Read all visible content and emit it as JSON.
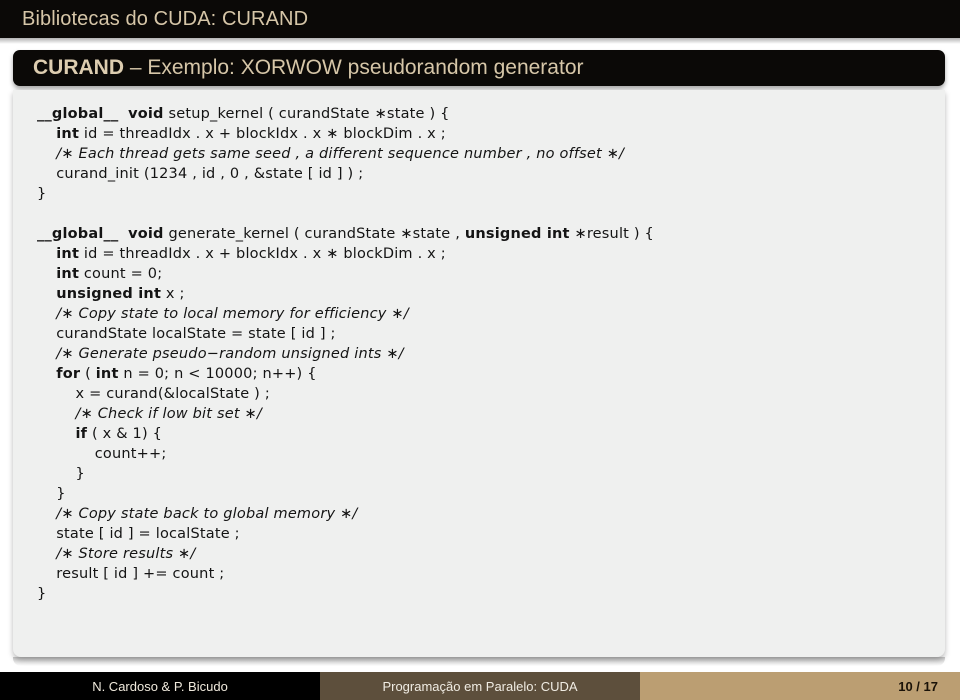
{
  "header": {
    "title": "Bibliotecas do CUDA: CURAND"
  },
  "frame": {
    "title_strong": "CURAND",
    "title_rest": " – Exemplo: XORWOW pseudorandom generator"
  },
  "code": {
    "language": "CUDA C",
    "lines": [
      {
        "id": "l01",
        "html": "<span class=\"kw\">__global__</span>  <span class=\"kw\">void</span> setup_kernel ( curandState ∗state ) {"
      },
      {
        "id": "l02",
        "html": "    <span class=\"kw\">int</span> id = threadIdx . x + blockIdx . x ∗ blockDim . x ;"
      },
      {
        "id": "l03",
        "html": "    <span class=\"cmt\">/∗ Each thread gets same seed , a different sequence number , no offset ∗/</span>"
      },
      {
        "id": "l04",
        "html": "    curand_init (1234 , id , 0 , &amp;state [ id ] ) ;"
      },
      {
        "id": "l05",
        "html": "}"
      },
      {
        "id": "l06",
        "html": ""
      },
      {
        "id": "l07",
        "html": "<span class=\"kw\">__global__</span>  <span class=\"kw\">void</span> generate_kernel ( curandState ∗state , <span class=\"kw\">unsigned int</span> ∗result ) {"
      },
      {
        "id": "l08",
        "html": "    <span class=\"kw\">int</span> id = threadIdx . x + blockIdx . x ∗ blockDim . x ;"
      },
      {
        "id": "l09",
        "html": "    <span class=\"kw\">int</span> count = 0;"
      },
      {
        "id": "l10",
        "html": "    <span class=\"kw\">unsigned int</span> x ;"
      },
      {
        "id": "l11",
        "html": "    <span class=\"cmt\">/∗ Copy state to local memory for efficiency ∗/</span>"
      },
      {
        "id": "l12",
        "html": "    curandState localState = state [ id ] ;"
      },
      {
        "id": "l13",
        "html": "    <span class=\"cmt\">/∗ Generate pseudo−random unsigned ints ∗/</span>"
      },
      {
        "id": "l14",
        "html": "    <span class=\"kw\">for</span> ( <span class=\"kw\">int</span> n = 0; n &lt; 10000; n++) {"
      },
      {
        "id": "l15",
        "html": "        x = curand(&amp;localState ) ;"
      },
      {
        "id": "l16",
        "html": "        <span class=\"cmt\">/∗ Check if low bit set ∗/</span>"
      },
      {
        "id": "l17",
        "html": "        <span class=\"kw\">if</span> ( x &amp; 1) {"
      },
      {
        "id": "l18",
        "html": "            count++;"
      },
      {
        "id": "l19",
        "html": "        }"
      },
      {
        "id": "l20",
        "html": "    }"
      },
      {
        "id": "l21",
        "html": "    <span class=\"cmt\">/∗ Copy state back to global memory ∗/</span>"
      },
      {
        "id": "l22",
        "html": "    state [ id ] = localState ;"
      },
      {
        "id": "l23",
        "html": "    <span class=\"cmt\">/∗ Store results ∗/</span>"
      },
      {
        "id": "l24",
        "html": "    result [ id ] += count ;"
      },
      {
        "id": "l25",
        "html": "}"
      }
    ]
  },
  "footer": {
    "author": "N. Cardoso & P. Bicudo",
    "course": "Programação em Paralelo: CUDA",
    "page": "10 / 17"
  },
  "colors": {
    "header_bg": "#0b0907",
    "header_text": "#d6c6a8",
    "panel_bg": "#eff0ef",
    "footer_author_bg": "#000000",
    "footer_course_bg": "#5d4f3c",
    "footer_page_bg": "#bb9e72"
  }
}
